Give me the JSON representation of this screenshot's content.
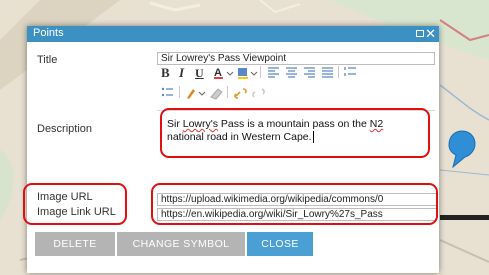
{
  "dialog": {
    "title": "Points"
  },
  "fields": {
    "title_label": "Title",
    "title_value": "Sir Lowrey's Pass Viewpoint",
    "description_label": "Description",
    "description_parts": [
      "Sir ",
      "Lowry's",
      " Pass is a mountain pass on the ",
      "N2",
      " national road in Western Cape."
    ],
    "image_url_label": "Image URL",
    "image_url_value": "https://upload.wikimedia.org/wikipedia/commons/0",
    "image_link_url_label": "Image Link URL",
    "image_link_url_value": "https://en.wikipedia.org/wiki/Sir_Lowry%27s_Pass"
  },
  "toolbar": {
    "bold": "B",
    "italic": "I",
    "underline": "U",
    "font_color": "A"
  },
  "buttons": {
    "delete": "DELETE",
    "change_symbol": "CHANGE SYMBOL",
    "close": "CLOSE"
  },
  "colors": {
    "titlebar": "#3d90c2",
    "close_button": "#4aa0d5",
    "disabled_button": "#b4b4b4",
    "highlight": "#e01010",
    "map_background": "#e6dfcf"
  },
  "icons": [
    "maximize-icon",
    "close-icon",
    "font-color-icon",
    "highlight-icon",
    "align-left-icon",
    "align-center-icon",
    "align-right-icon",
    "justify-icon",
    "ordered-list-icon",
    "unordered-list-icon",
    "paint-icon",
    "eraser-icon",
    "link-icon",
    "unlink-icon",
    "map-marker-icon"
  ]
}
